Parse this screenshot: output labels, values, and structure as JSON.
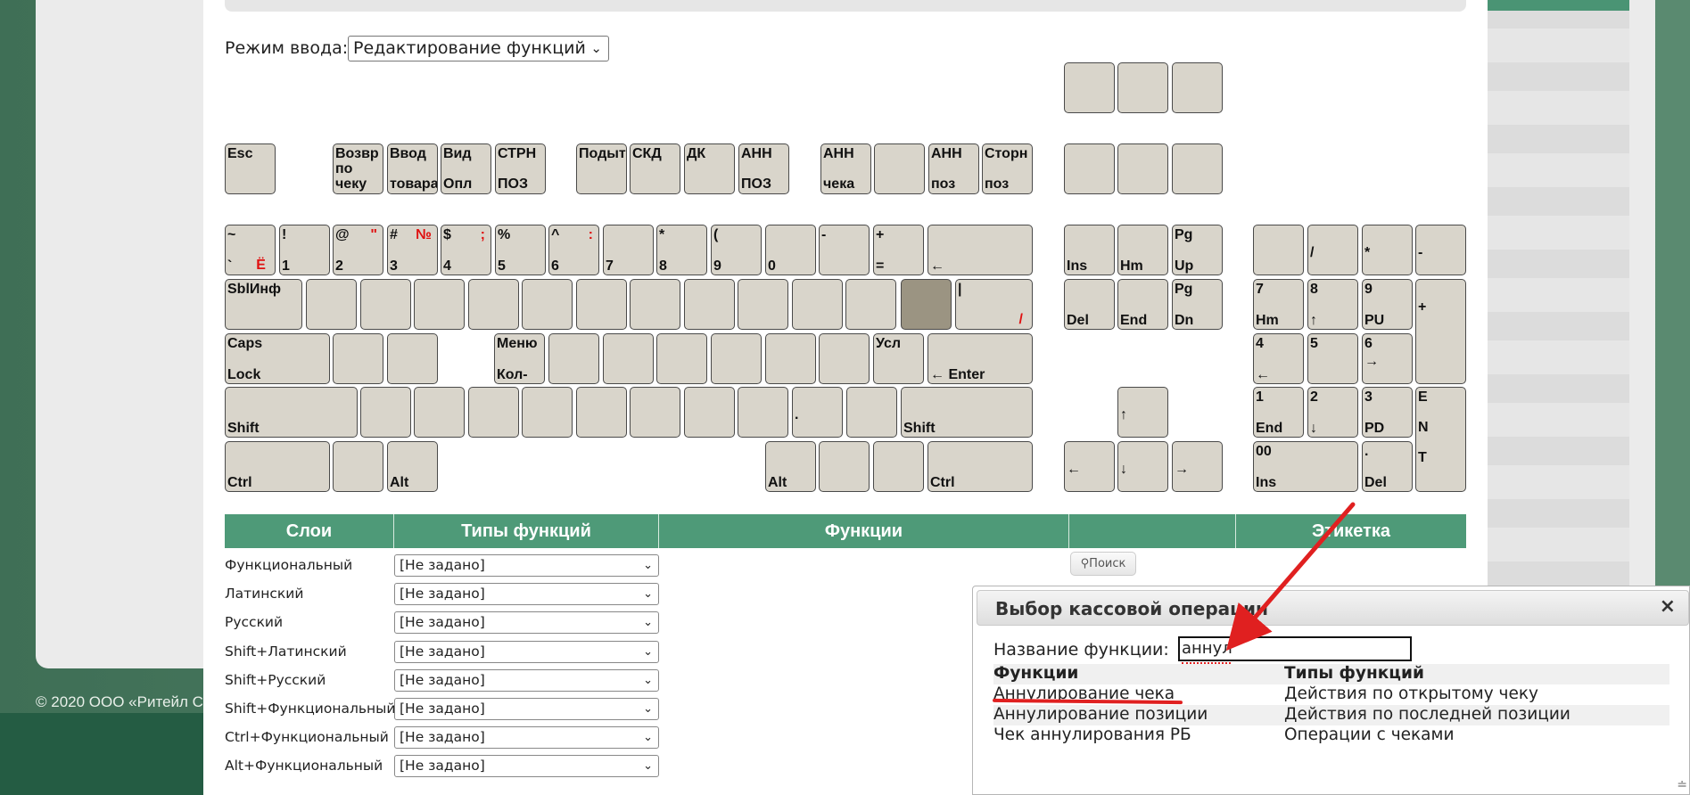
{
  "copyright": "© 2020 ООО «Ритейл С",
  "mode": {
    "label": "Режим ввода:",
    "value": "Редактирование функций"
  },
  "keys": [
    {
      "id": "f1",
      "t": "Esc"
    },
    {
      "id": "f2",
      "t": "Возвр\nпо\nчеку"
    },
    {
      "id": "f3",
      "t": "Ввод\n\nтовара"
    },
    {
      "id": "f4",
      "t": "Вид\n\nОпл"
    },
    {
      "id": "f5",
      "t": "СТРН\n\nПОЗ"
    },
    {
      "id": "f6",
      "t": "Подыт"
    },
    {
      "id": "f7",
      "t": "СКД"
    },
    {
      "id": "f8",
      "t": "ДК"
    },
    {
      "id": "f9",
      "t": "АНН\n\nПОЗ"
    },
    {
      "id": "f10",
      "t": "АНН\n\nчека"
    },
    {
      "id": "f11",
      "t": ""
    },
    {
      "id": "f12",
      "t": "АНН\n\nпоз"
    },
    {
      "id": "f13",
      "t": "Сторн\n\nпоз"
    },
    {
      "id": "tilde",
      "t": "~",
      "b": "`",
      "br": "Ё"
    },
    {
      "id": "d1",
      "t": "!",
      "b": "1"
    },
    {
      "id": "d2",
      "t": "@",
      "b": "2",
      "tr": "\""
    },
    {
      "id": "d3",
      "t": "#",
      "b": "3",
      "tr": "№"
    },
    {
      "id": "d4",
      "t": "$",
      "b": "4",
      "tr": ";"
    },
    {
      "id": "d5",
      "t": "%",
      "b": "5"
    },
    {
      "id": "d6",
      "t": "^",
      "b": "6",
      "tr": ":"
    },
    {
      "id": "d7",
      "t": "",
      "b": "7"
    },
    {
      "id": "d8",
      "t": "*",
      "b": "8"
    },
    {
      "id": "d9",
      "t": "(",
      "b": "9"
    },
    {
      "id": "d0",
      "t": "",
      "b": "0"
    },
    {
      "id": "minus",
      "t": "-",
      "b": ""
    },
    {
      "id": "plus",
      "t": "+",
      "b": "="
    },
    {
      "id": "backspace",
      "b": "←"
    },
    {
      "id": "tab",
      "t": "SblИнф"
    },
    {
      "id": "pipe",
      "t": "|",
      "br": "/"
    },
    {
      "id": "caps",
      "t": "Caps",
      "b": "Lock"
    },
    {
      "id": "menu",
      "t": "Меню",
      "b": "Кол-"
    },
    {
      "id": "usl",
      "t": "Усл"
    },
    {
      "id": "enter",
      "b": "← Enter"
    },
    {
      "id": "lshift",
      "b": "Shift"
    },
    {
      "id": "dot",
      "m": "."
    },
    {
      "id": "rshift",
      "b": "Shift"
    },
    {
      "id": "lctrl",
      "b": "Ctrl"
    },
    {
      "id": "lalt",
      "b": "Alt"
    },
    {
      "id": "ralt",
      "b": "Alt"
    },
    {
      "id": "rctrl",
      "b": "Ctrl"
    },
    {
      "id": "ins",
      "b": "Ins"
    },
    {
      "id": "hm",
      "b": "Hm"
    },
    {
      "id": "pgup",
      "t": "Pg",
      "b": "Up"
    },
    {
      "id": "del",
      "b": "Del"
    },
    {
      "id": "end",
      "b": "End"
    },
    {
      "id": "pgdn",
      "t": "Pg",
      "b": "Dn"
    },
    {
      "id": "up",
      "m": "↑"
    },
    {
      "id": "left",
      "m": "←"
    },
    {
      "id": "down",
      "m": "↓"
    },
    {
      "id": "right",
      "m": "→"
    },
    {
      "id": "np_slash",
      "m": "/"
    },
    {
      "id": "np_star",
      "m": "*"
    },
    {
      "id": "np_minus",
      "m": "-"
    },
    {
      "id": "np7",
      "t": "7",
      "b": "Hm"
    },
    {
      "id": "np8",
      "t": "8",
      "b": "↑"
    },
    {
      "id": "np9",
      "t": "9",
      "b": "PU"
    },
    {
      "id": "np_plus",
      "m": "+"
    },
    {
      "id": "np4",
      "t": "4",
      "b": "←"
    },
    {
      "id": "np5",
      "t": "5"
    },
    {
      "id": "np6",
      "t": "6",
      "m": "→"
    },
    {
      "id": "np1",
      "t": "1",
      "b": "End"
    },
    {
      "id": "np2",
      "t": "2",
      "b": "↓"
    },
    {
      "id": "np3",
      "t": "3",
      "b": "PD"
    },
    {
      "id": "np_enter",
      "t": "E\n\nN\n\nT"
    },
    {
      "id": "np0",
      "t": "00",
      "b": "Ins"
    },
    {
      "id": "np_dot",
      "t": ".",
      "b": "Del"
    }
  ],
  "table_header": [
    "Слои",
    "Типы функций",
    "Функции",
    "",
    "Этикетка"
  ],
  "layers": [
    {
      "label": "Функциональный",
      "value": "[Не задано]"
    },
    {
      "label": "Латинский",
      "value": "[Не задано]"
    },
    {
      "label": "Русский",
      "value": "[Не задано]"
    },
    {
      "label": "Shift+Латинский",
      "value": "[Не задано]"
    },
    {
      "label": "Shift+Русский",
      "value": "[Не задано]"
    },
    {
      "label": "Shift+Функциональный",
      "value": "[Не задано]"
    },
    {
      "label": "Ctrl+Функциональный",
      "value": "[Не задано]"
    },
    {
      "label": "Alt+Функциональный",
      "value": "[Не задано]"
    }
  ],
  "search_button": "Поиск",
  "dialog": {
    "title": "Выбор кассовой операции",
    "func_label": "Название функции:",
    "func_value": "аннул",
    "columns": [
      "Функции",
      "Типы функций"
    ],
    "rows": [
      {
        "func": "Аннулирование чека",
        "type": "Действия по открытому чеку"
      },
      {
        "func": "Аннулирование позиции",
        "type": "Действия по последней позиции"
      },
      {
        "func": "Чек аннулирования РБ",
        "type": "Операции с чеками"
      }
    ]
  },
  "colors": {
    "header_green": "#4e9a78",
    "key_face": "#d9d5cb",
    "key_selected": "#9b9482",
    "annotation_red": "#e02020"
  }
}
